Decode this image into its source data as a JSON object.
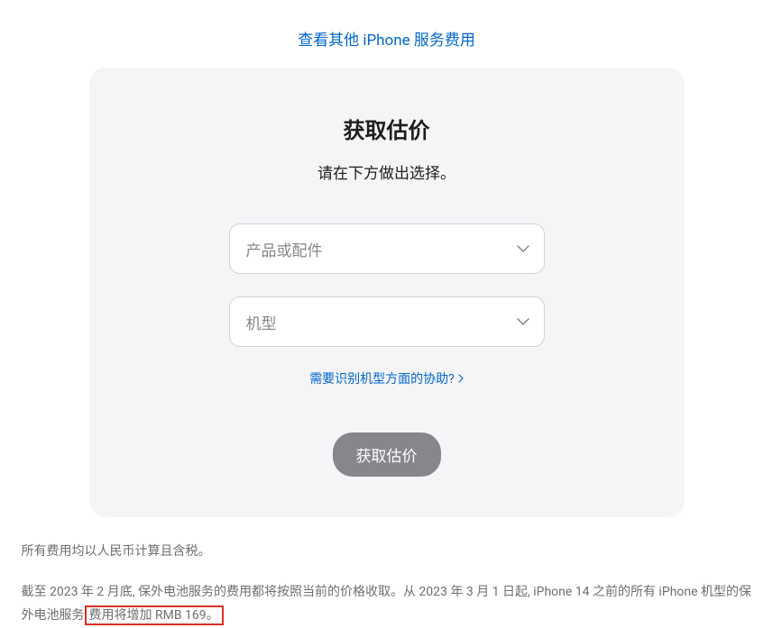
{
  "topLink": {
    "text": "查看其他 iPhone 服务费用"
  },
  "card": {
    "title": "获取估价",
    "subtitle": "请在下方做出选择。",
    "select1": {
      "placeholder": "产品或配件"
    },
    "select2": {
      "placeholder": "机型"
    },
    "helpLink": {
      "text": "需要识别机型方面的协助?"
    },
    "submitButton": {
      "label": "获取估价"
    }
  },
  "footer": {
    "note1": "所有费用均以人民币计算且含税。",
    "note2_part1": "截至 2023 年 2 月底, 保外电池服务的费用都将按照当前的价格收取。从 2023 年 3 月 1 日起, iPhone 14 之前的所有 iPhone 机型的保外电池服务",
    "note2_highlight": "费用将增加 RMB 169。"
  }
}
